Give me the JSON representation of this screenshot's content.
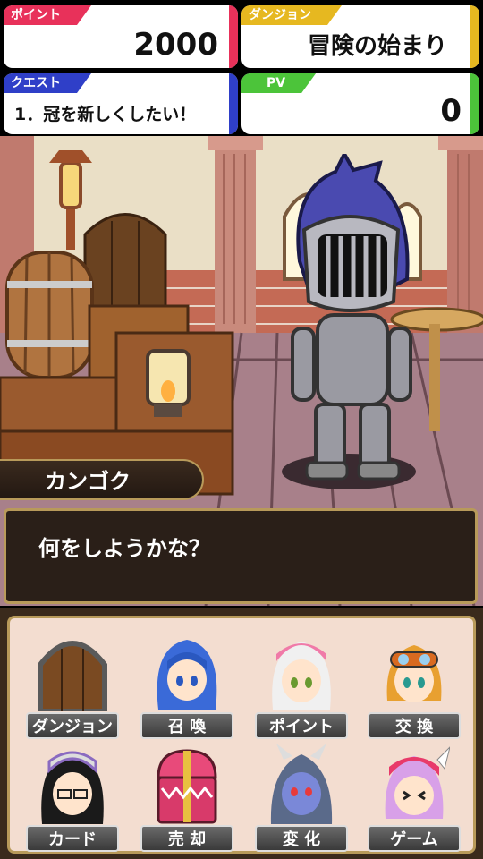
{
  "hud": {
    "points": {
      "label": "ポイント",
      "value": "2000"
    },
    "dungeon": {
      "label": "ダンジョン",
      "value": "冒険の始まり"
    },
    "quest": {
      "label": "クエスト",
      "value": "1．冠を新しくしたい！"
    },
    "pv": {
      "label": "PV",
      "value": "0"
    }
  },
  "speaker": "カンゴク",
  "dialogue": "何をしようかな？",
  "menu": [
    {
      "label": "ダンジョン",
      "icon": "dungeon-door-icon"
    },
    {
      "label": "召 喚",
      "icon": "blue-hair-girl-icon"
    },
    {
      "label": "ポイント",
      "icon": "pink-helmet-girl-icon"
    },
    {
      "label": "交 換",
      "icon": "goggles-girl-icon"
    },
    {
      "label": "カード",
      "icon": "glasses-elf-girl-icon"
    },
    {
      "label": "売 却",
      "icon": "treasure-chest-mimic-icon"
    },
    {
      "label": "変 化",
      "icon": "demon-face-icon"
    },
    {
      "label": "ゲーム",
      "icon": "winged-helmet-girl-icon"
    }
  ],
  "colors": {
    "points": "#e8315a",
    "dungeon": "#e6b820",
    "quest": "#2f3fc8",
    "pv": "#4cc43a"
  }
}
